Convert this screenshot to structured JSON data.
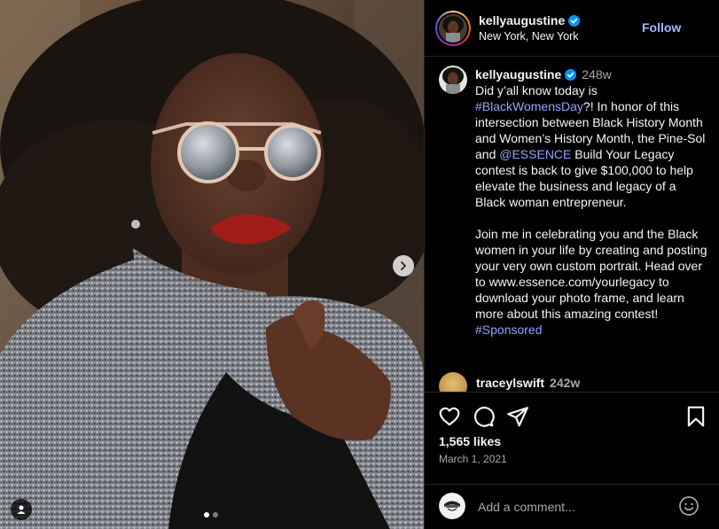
{
  "post": {
    "username": "kellyaugustine",
    "location": "New York, New York",
    "follow_label": "Follow"
  },
  "caption": {
    "username": "kellyaugustine",
    "time": "248w",
    "segments": [
      {
        "type": "text",
        "text": "Did y’all know today is\n"
      },
      {
        "type": "hashtag",
        "text": "#BlackWomensDay"
      },
      {
        "type": "text",
        "text": "?! In honor of this intersection between Black History Month and Women’s History Month, the Pine-Sol and "
      },
      {
        "type": "mention",
        "text": "@ESSENCE"
      },
      {
        "type": "text",
        "text": " Build Your Legacy contest is back to give $100,000 to help elevate the business and legacy of a Black woman entrepreneur.\n\nJoin me in celebrating you and the Black women in your life by creating and posting your very own custom portrait. Head over to www.essence.com/yourlegacy to download your photo frame, and learn more about this amazing contest!\n"
      },
      {
        "type": "hashtag",
        "text": "#Sponsored"
      }
    ]
  },
  "comments": [
    {
      "username": "traceylswift",
      "time": "242w"
    }
  ],
  "stats": {
    "likes": "1,565 likes",
    "date": "March 1, 2021"
  },
  "comment_box": {
    "placeholder": "Add a comment..."
  },
  "carousel": {
    "current": 1,
    "total": 2
  },
  "icons": {
    "like": "heart-icon",
    "comment": "comment-icon",
    "share": "share-icon",
    "save": "bookmark-icon",
    "emoji": "emoji-icon",
    "next": "chevron-right-icon",
    "tags": "user-tag-icon",
    "verified": "verified-badge-icon"
  },
  "colors": {
    "background": "#000000",
    "text": "#f5f5f5",
    "secondary_text": "#a8a8a8",
    "link": "#8da6ff",
    "follow": "#a6b4ff",
    "verified": "#0095f6"
  }
}
